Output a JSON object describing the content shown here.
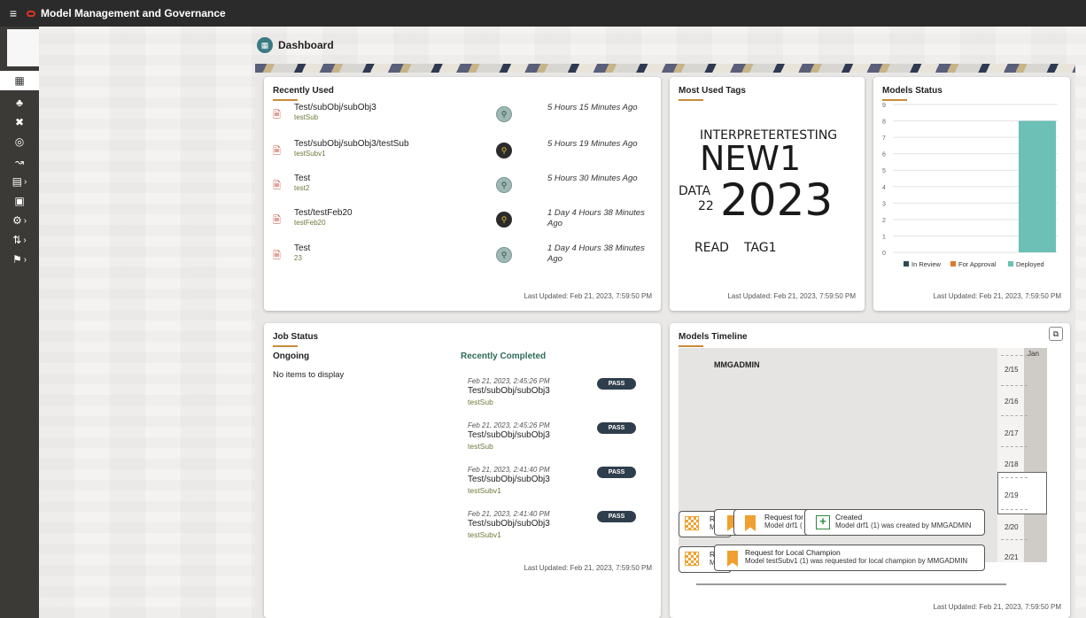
{
  "app": {
    "title": "Model Management and Governance"
  },
  "page": {
    "title": "Dashboard"
  },
  "recently_used": {
    "title": "Recently Used",
    "items": [
      {
        "path": "Test/subObj/subObj3",
        "sub": "testSub",
        "time": "5 Hours 15 Minutes Ago",
        "trophy": "light"
      },
      {
        "path": "Test/subObj/subObj3/testSub",
        "sub": "testSubv1",
        "time": "5 Hours 19 Minutes Ago",
        "trophy": "dark"
      },
      {
        "path": "Test",
        "sub": "test2",
        "time": "5 Hours 30 Minutes Ago",
        "trophy": "light"
      },
      {
        "path": "Test/testFeb20",
        "sub": "testFeb20",
        "time": "1 Day 4 Hours 38 Minutes Ago",
        "trophy": "dark"
      },
      {
        "path": "Test",
        "sub": "23",
        "time": "1 Day 4 Hours 38 Minutes Ago",
        "trophy": "light"
      }
    ],
    "last_updated": "Last Updated: Feb 21, 2023, 7:59:50 PM"
  },
  "most_used_tags": {
    "title": "Most Used Tags",
    "tags": [
      "INTERPRETERTESTING",
      "NEW1",
      "DATA",
      "22",
      "2023",
      "READ",
      "TAG1"
    ],
    "last_updated": "Last Updated: Feb 21, 2023, 7:59:50 PM"
  },
  "models_status": {
    "title": "Models Status",
    "last_updated": "Last Updated: Feb 21, 2023, 7:59:50 PM"
  },
  "chart_data": {
    "type": "bar",
    "title": "Models Status",
    "categories": [
      "In Review",
      "For Approval",
      "Deployed"
    ],
    "series": [
      {
        "name": "In Review",
        "values": [
          0
        ],
        "color": "#2f4a52"
      },
      {
        "name": "For Approval",
        "values": [
          0
        ],
        "color": "#e07a2e"
      },
      {
        "name": "Deployed",
        "values": [
          8
        ],
        "color": "#6cc0b6"
      }
    ],
    "yticks": [
      "0",
      "1",
      "2",
      "3",
      "4",
      "5",
      "6",
      "7",
      "8",
      "9"
    ],
    "ylim": [
      0,
      9
    ],
    "legend": "bottom",
    "grid": true
  },
  "job_status": {
    "title": "Job Status",
    "ongoing_label": "Ongoing",
    "ongoing_empty": "No items to display",
    "completed_label": "Recently Completed",
    "completed": [
      {
        "date": "Feb 21, 2023, 2:45:26 PM",
        "path": "Test/subObj/subObj3",
        "sub": "testSub",
        "status": "PASS"
      },
      {
        "date": "Feb 21, 2023, 2:45:26 PM",
        "path": "Test/subObj/subObj3",
        "sub": "testSub",
        "status": "PASS"
      },
      {
        "date": "Feb 21, 2023, 2:41:40 PM",
        "path": "Test/subObj/subObj3",
        "sub": "testSubv1",
        "status": "PASS"
      },
      {
        "date": "Feb 21, 2023, 2:41:40 PM",
        "path": "Test/subObj/subObj3",
        "sub": "testSubv1",
        "status": "PASS"
      }
    ],
    "last_updated": "Last Updated: Feb 21, 2023, 7:59:50 PM"
  },
  "models_timeline": {
    "title": "Models Timeline",
    "user": "MMGADMIN",
    "month": "Jan",
    "dates": [
      "2/15",
      "2/16",
      "2/17",
      "2/18",
      "2/19",
      "2/20",
      "2/21"
    ],
    "cards": {
      "c1_title": "Re",
      "c1_text": "Mc",
      "c2_title": "Request for",
      "c2_text": "Model drf1 (",
      "c3_title": "Created",
      "c3_text": "Model drf1 (1) was created by MMGADMIN",
      "c4_title": "Re",
      "c4_text": "Mc",
      "c5_title": "Request for Local Champion",
      "c5_text": "Model testSubv1 (1) was requested for local champion by MMGADMIN"
    },
    "last_updated": "Last Updated: Feb 21, 2023, 7:59:50 PM"
  }
}
